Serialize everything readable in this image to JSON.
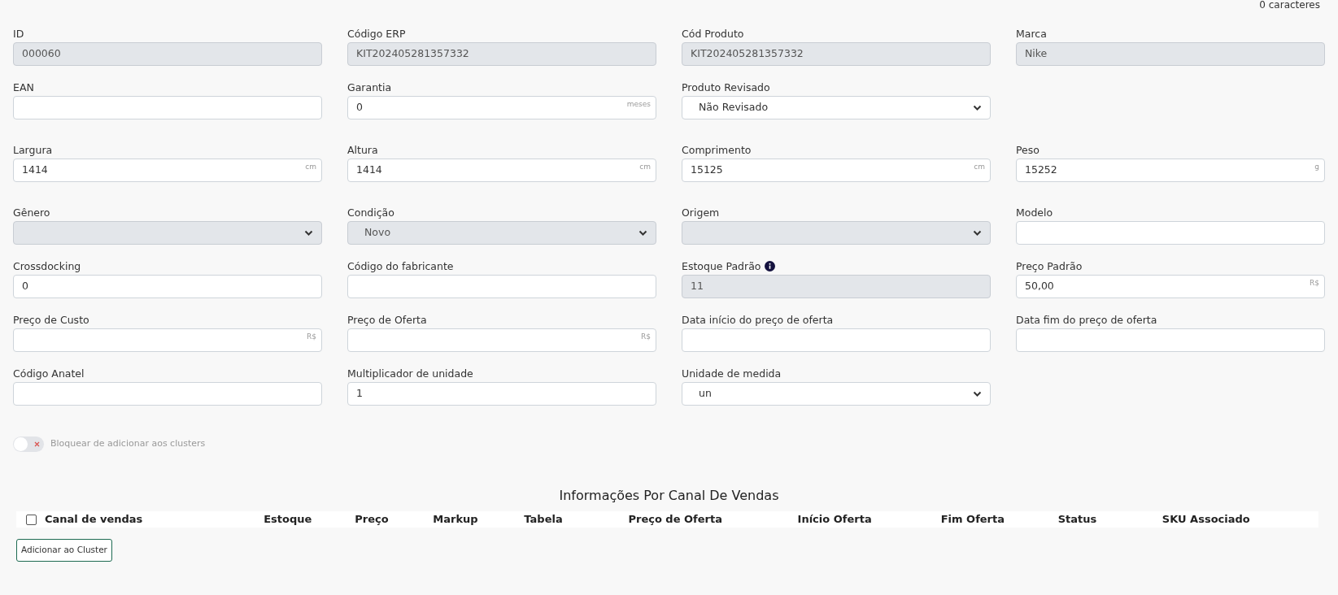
{
  "char_counter": "0 caracteres",
  "form_rows": [
    [
      {
        "label": "ID",
        "kind": "input",
        "value": "000060",
        "disabled": true
      },
      {
        "label": "Código ERP",
        "kind": "input",
        "value": "KIT202405281357332",
        "disabled": true
      },
      {
        "label": "Cód Produto",
        "kind": "input",
        "value": "KIT202405281357332",
        "disabled": true
      },
      {
        "label": "Marca",
        "kind": "input",
        "value": "Nike",
        "disabled": true
      }
    ],
    [
      {
        "label": "EAN",
        "kind": "input",
        "disabled": false
      },
      {
        "label": "Garantia",
        "kind": "input",
        "value": "0",
        "unit": "meses",
        "disabled": false
      },
      {
        "label": "Produto Revisado",
        "kind": "select",
        "value": "Não Revisado",
        "disabled": false
      },
      {
        "kind": "empty"
      }
    ],
    [
      {
        "label": "Largura",
        "kind": "input",
        "value": "1414",
        "unit": "cm",
        "disabled": false
      },
      {
        "label": "Altura",
        "kind": "input",
        "value": "1414",
        "unit": "cm",
        "disabled": false
      },
      {
        "label": "Comprimento",
        "kind": "input",
        "value": "15125",
        "unit": "cm",
        "disabled": false
      },
      {
        "label": "Peso",
        "kind": "input",
        "value": "15252",
        "unit": "g",
        "disabled": false
      }
    ],
    [
      {
        "label": "Gênero",
        "kind": "select",
        "disabled": true
      },
      {
        "label": "Condição",
        "kind": "select",
        "value": "Novo",
        "disabled": true
      },
      {
        "label": "Origem",
        "kind": "select",
        "disabled": true
      },
      {
        "label": "Modelo",
        "kind": "input",
        "disabled": false
      }
    ],
    [
      {
        "label": "Crossdocking",
        "kind": "input",
        "value": "0",
        "disabled": false
      },
      {
        "label": "Código do fabricante",
        "kind": "input",
        "disabled": false
      },
      {
        "label": "Estoque Padrão",
        "kind": "input",
        "value": "11",
        "info": true,
        "disabled": true
      },
      {
        "label": "Preço Padrão",
        "kind": "input",
        "value": "50,00",
        "unit": "R$",
        "disabled": false
      }
    ],
    [
      {
        "label": "Preço de Custo",
        "kind": "input",
        "unit": "R$",
        "disabled": false
      },
      {
        "label": "Preço de Oferta",
        "kind": "input",
        "unit": "R$",
        "disabled": false
      },
      {
        "label": "Data início do preço de oferta",
        "kind": "input",
        "disabled": false
      },
      {
        "label": "Data fim do preço de oferta",
        "kind": "input",
        "disabled": false
      }
    ],
    [
      {
        "label": "Código Anatel",
        "kind": "input",
        "disabled": false
      },
      {
        "label": "Multiplicador de unidade",
        "kind": "input",
        "value": "1",
        "disabled": false
      },
      {
        "label": "Unidade de medida",
        "kind": "select",
        "value": "un",
        "disabled": false
      },
      {
        "kind": "empty"
      }
    ]
  ],
  "block_toggle": {
    "label": "Bloquear de adicionar aos clusters",
    "on": false
  },
  "channels_section": {
    "title": "Informações Por Canal De Vendas",
    "select_all_checked": false,
    "columns": [
      "Canal de vendas",
      "Estoque",
      "Preço",
      "Markup",
      "Tabela",
      "Preço de Oferta",
      "Início Oferta",
      "Fim Oferta",
      "Status",
      "SKU Associado"
    ],
    "add_button": "Adicionar ao Cluster"
  }
}
